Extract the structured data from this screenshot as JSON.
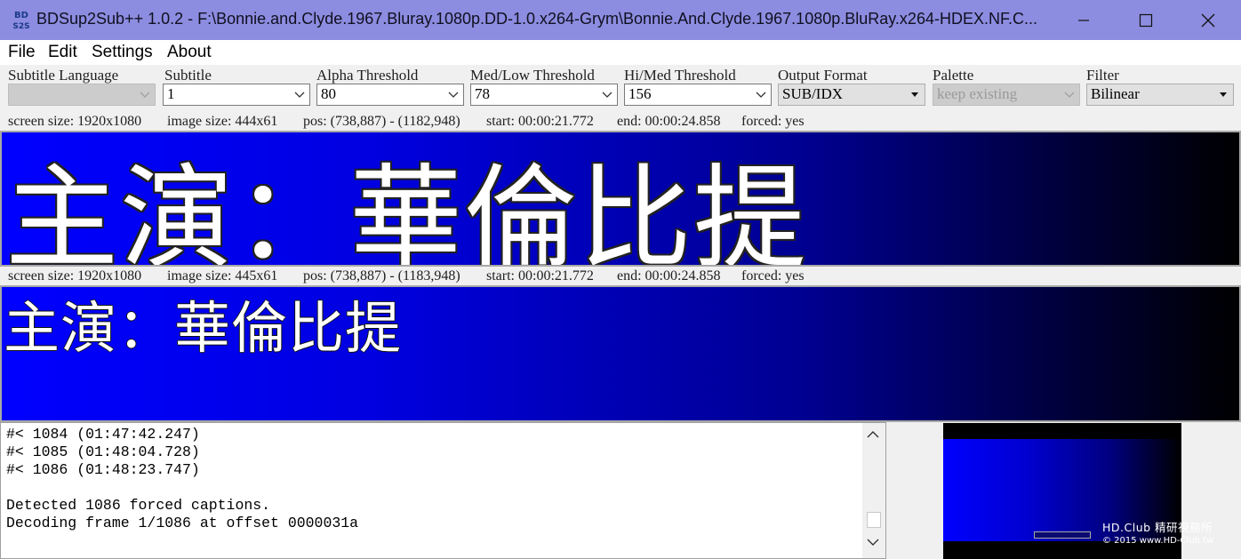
{
  "window": {
    "title": "BDSup2Sub++ 1.0.2 - F:\\Bonnie.and.Clyde.1967.Bluray.1080p.DD-1.0.x264-Grym\\Bonnie.And.Clyde.1967.1080p.BluRay.x264-HDEX.NF.C...",
    "app_icon_text_top": "BD",
    "app_icon_text_bottom": "S2S"
  },
  "menu": {
    "items": [
      "File",
      "Edit",
      "Settings",
      "About"
    ]
  },
  "toolbar": {
    "fields": [
      {
        "label": "Subtitle Language",
        "value": "",
        "enabled": false
      },
      {
        "label": "Subtitle",
        "value": "1",
        "enabled": true
      },
      {
        "label": "Alpha Threshold",
        "value": "80",
        "enabled": true
      },
      {
        "label": "Med/Low Threshold",
        "value": "78",
        "enabled": true
      },
      {
        "label": "Hi/Med Threshold",
        "value": "156",
        "enabled": true
      },
      {
        "label": "Output Format",
        "value": "SUB/IDX",
        "enabled": true
      },
      {
        "label": "Palette",
        "value": "keep existing",
        "enabled": false
      },
      {
        "label": "Filter",
        "value": "Bilinear",
        "enabled": true
      }
    ]
  },
  "source_info": {
    "screen_size": "screen size: 1920x1080",
    "image_size": "image size: 444x61",
    "pos": "pos: (738,887) - (1182,948)",
    "start": "start: 00:00:21.772",
    "end": "end: 00:00:24.858",
    "forced": "forced: yes"
  },
  "target_info": {
    "screen_size": "screen size: 1920x1080",
    "image_size": "image size: 445x61",
    "pos": "pos: (738,887) - (1183,948)",
    "start": "start: 00:00:21.772",
    "end": "end: 00:00:24.858",
    "forced": "forced: yes"
  },
  "preview": {
    "source_subtitle": "主演：華倫比提",
    "target_subtitle": "主演：華倫比提"
  },
  "log": {
    "lines": [
      "#< 1084 (01:47:42.247)",
      "#< 1085 (01:48:04.728)",
      "#< 1086 (01:48:23.747)",
      "",
      "Detected 1086 forced captions.",
      "Decoding frame 1/1086 at offset 0000031a"
    ]
  },
  "watermark": {
    "line1": "HD.Club 精研視務所",
    "line2": "© 2015  www.HD-Club.tw"
  },
  "colors": {
    "titlebar": "#8c8ce0",
    "preview_gradient_start": "#0000ff",
    "preview_gradient_end": "#000000"
  }
}
